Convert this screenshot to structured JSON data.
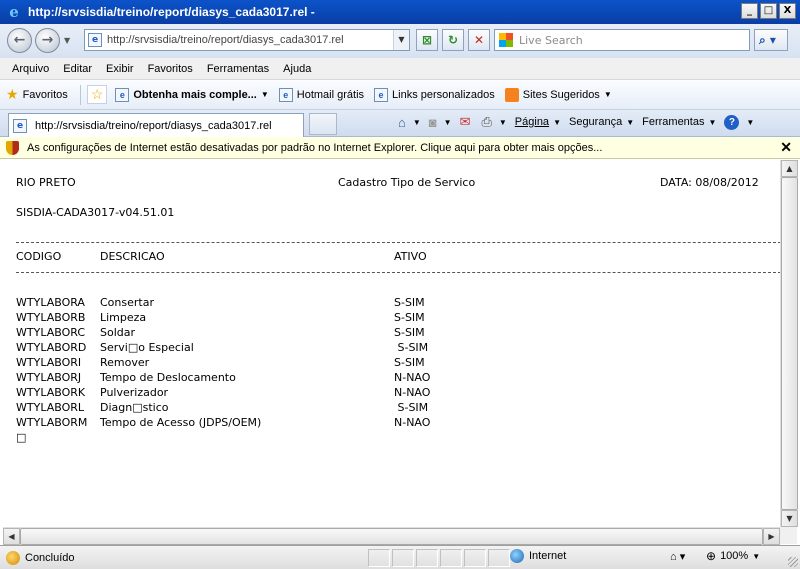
{
  "window": {
    "title": "http://srvsisdia/treino/report/diasys_cada3017.rel -",
    "min": "_",
    "max": "□",
    "close": "X"
  },
  "address": {
    "url": "http://srvsisdia/treino/report/diasys_cada3017.rel",
    "search_placeholder": "Live Search"
  },
  "menu": [
    "Arquivo",
    "Editar",
    "Exibir",
    "Favoritos",
    "Ferramentas",
    "Ajuda"
  ],
  "favorites": {
    "label": "Favoritos",
    "items": [
      "Obtenha mais comple...",
      "Hotmail grátis",
      "Links personalizados",
      "Sites Sugeridos"
    ]
  },
  "tab": {
    "title": "http://srvsisdia/treino/report/diasys_cada3017.rel"
  },
  "commands": {
    "page": "Página",
    "security": "Segurança",
    "tools": "Ferramentas"
  },
  "infobar": {
    "message": "As configurações de Internet estão desativadas por padrão no Internet Explorer. Clique aqui para obter mais opções..."
  },
  "report": {
    "city": "RIO PRETO",
    "title": "Cadastro Tipo de Servico",
    "date": "DATA: 08/08/2012",
    "program": "SISDIA-CADA3017-v04.51.01",
    "headers": {
      "codigo": "CODIGO",
      "descricao": "DESCRICAO",
      "ativo": "ATIVO"
    },
    "rows": [
      {
        "codigo": "WTYLABORA",
        "descricao": "Consertar",
        "ativo": "S-SIM"
      },
      {
        "codigo": "WTYLABORB",
        "descricao": "Limpeza",
        "ativo": "S-SIM"
      },
      {
        "codigo": "WTYLABORC",
        "descricao": "Soldar",
        "ativo": "S-SIM"
      },
      {
        "codigo": "WTYLABORD",
        "descricao": "Servi□o Especial",
        "ativo": " S-SIM"
      },
      {
        "codigo": "WTYLABORI",
        "descricao": "Remover",
        "ativo": "S-SIM"
      },
      {
        "codigo": "WTYLABORJ",
        "descricao": "Tempo de Deslocamento",
        "ativo": "N-NAO"
      },
      {
        "codigo": "WTYLABORK",
        "descricao": "Pulverizador",
        "ativo": "N-NAO"
      },
      {
        "codigo": "WTYLABORL",
        "descricao": "Diagn□stico",
        "ativo": " S-SIM"
      },
      {
        "codigo": "WTYLABORM",
        "descricao": "Tempo de Acesso (JDPS/OEM)",
        "ativo": "N-NAO"
      }
    ],
    "end_marker": "□"
  },
  "status": {
    "text": "Concluído",
    "zone": "Internet",
    "zoom": "100%"
  }
}
